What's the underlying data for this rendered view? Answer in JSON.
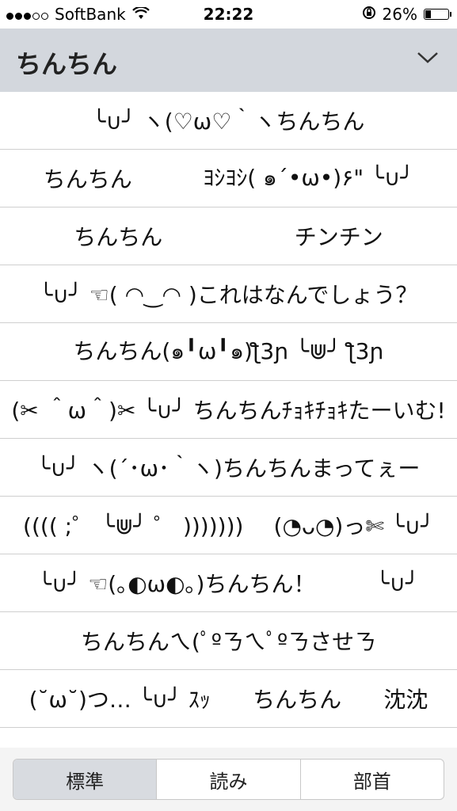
{
  "status": {
    "carrier": "SoftBank",
    "time": "22:22",
    "battery_text": "26%",
    "battery_level": 0.26,
    "signal_bars_filled": 3,
    "signal_bars_total": 5
  },
  "header": {
    "title": "ちんちん",
    "dropdown_icon": "chevron-down-icon"
  },
  "rows": [
    {
      "items": [
        "╰∪╯ ヽ(♡ω♡｀ヽちんちん"
      ]
    },
    {
      "items": [
        "ちんちん",
        "ﾖｼﾖｼ( ๑´•ω•)۶\" ╰∪╯"
      ]
    },
    {
      "items": [
        "ちんちん",
        "チンチン"
      ]
    },
    {
      "items": [
        "╰∪╯ ☜( ◠‿◠ )これはなんでしょう？"
      ]
    },
    {
      "items": [
        "ちんちん(๑╹ω╹๑)ƪ3ɲ ╰⋓╯ ƪ3ɲ"
      ]
    },
    {
      "items": [
        "(✂︎ ＾ω＾)✂︎ ╰∪╯ ちんちんﾁｮｷﾁｮｷたーいむ!"
      ]
    },
    {
      "items": [
        "╰∪╯ ヽ(´･ω･｀ヽ)ちんちんまってぇー"
      ]
    },
    {
      "items": [
        "(((( ;゜ ╰⋓╯ ゜ )))))))",
        "(◔ᴗ◔)っ✄ ╰∪╯"
      ]
    },
    {
      "items": [
        "╰∪╯ ☜(｡◐ω◐｡)ちんちん！",
        "╰∪╯"
      ]
    },
    {
      "items": [
        "ちんちんㄟ(ﾟºㄋㄟﾟºㄋさせㄋ"
      ]
    },
    {
      "items": [
        "(˘ω˘)つ… ╰∪╯ ｽｯ",
        "ちんちん",
        "沈沈"
      ]
    }
  ],
  "segments": {
    "standard": "標準",
    "reading": "読み",
    "radical": "部首",
    "selected": "standard"
  }
}
